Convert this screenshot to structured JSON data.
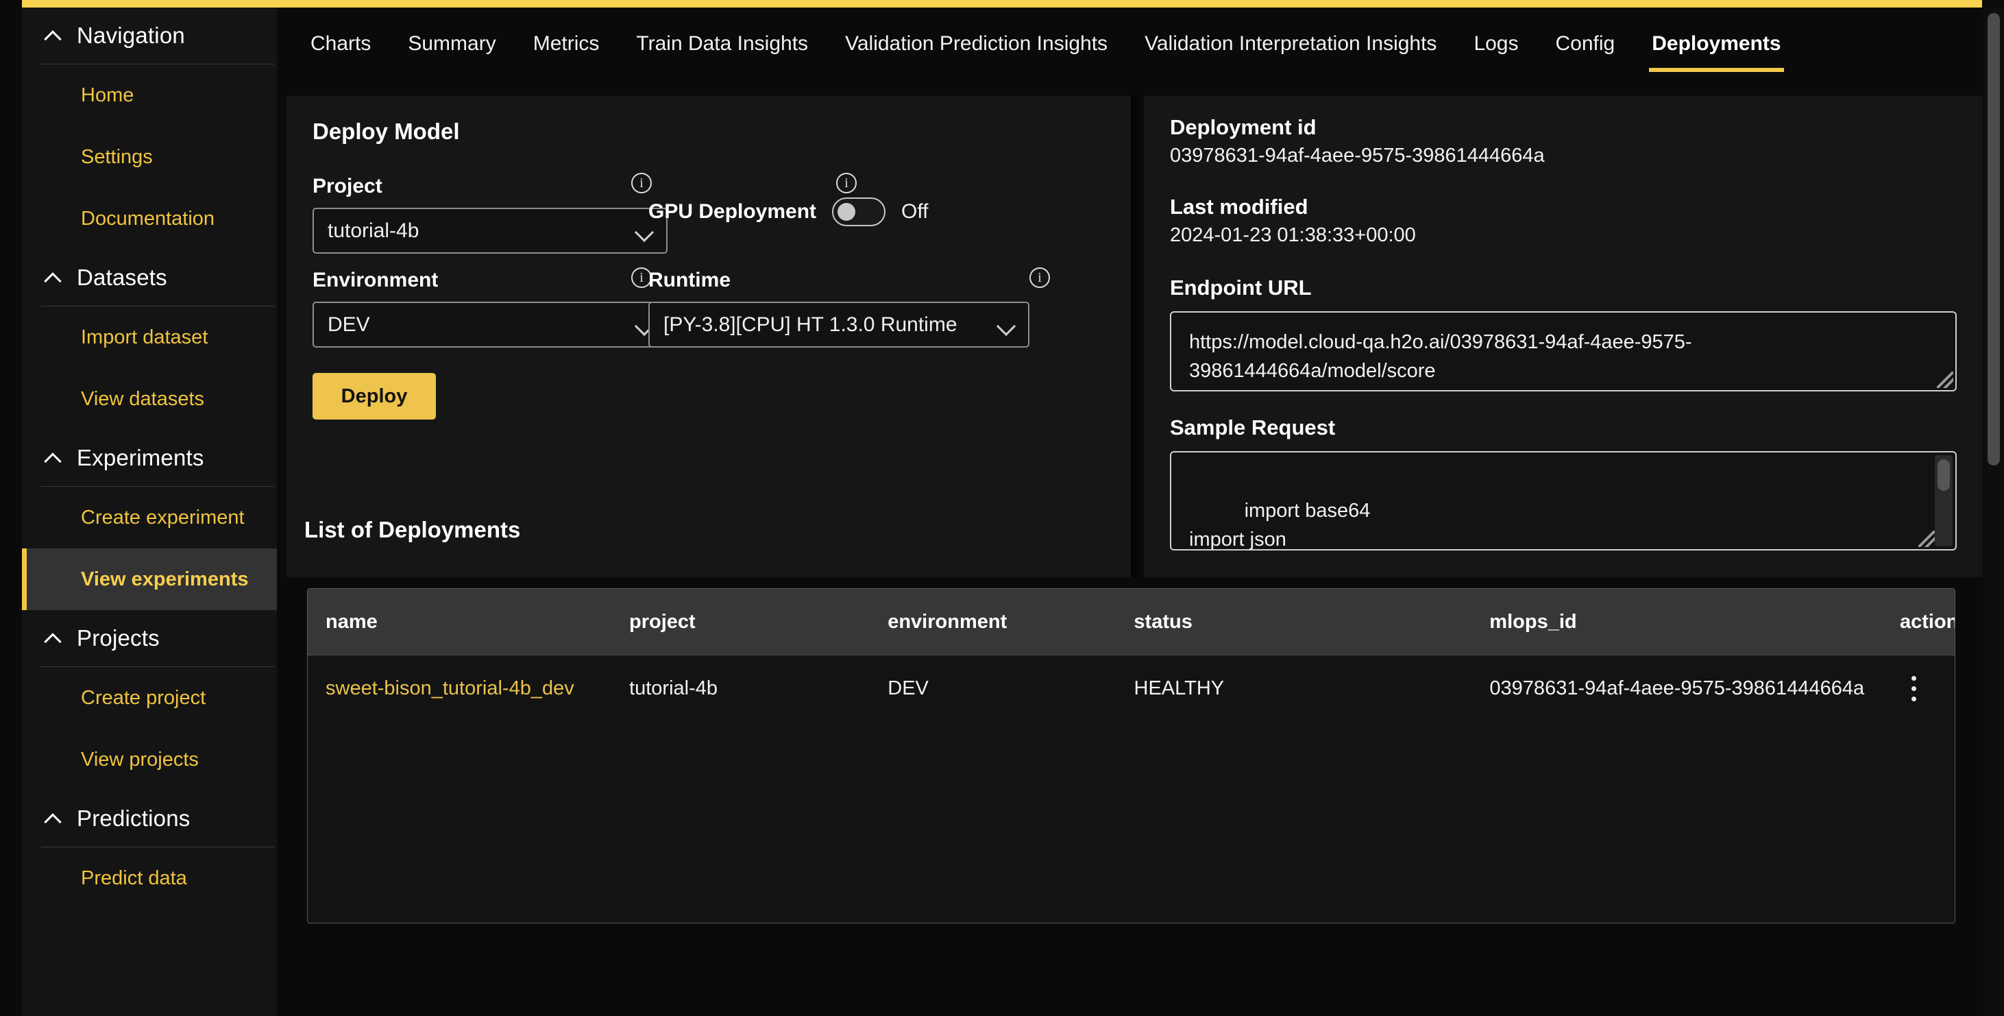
{
  "sidebar": {
    "groups": [
      {
        "title": "Navigation",
        "items": [
          {
            "label": "Home",
            "selected": false
          },
          {
            "label": "Settings",
            "selected": false
          },
          {
            "label": "Documentation",
            "selected": false
          }
        ]
      },
      {
        "title": "Datasets",
        "items": [
          {
            "label": "Import dataset",
            "selected": false
          },
          {
            "label": "View datasets",
            "selected": false
          }
        ]
      },
      {
        "title": "Experiments",
        "items": [
          {
            "label": "Create experiment",
            "selected": false
          },
          {
            "label": "View experiments",
            "selected": true
          }
        ]
      },
      {
        "title": "Projects",
        "items": [
          {
            "label": "Create project",
            "selected": false
          },
          {
            "label": "View projects",
            "selected": false
          }
        ]
      },
      {
        "title": "Predictions",
        "items": [
          {
            "label": "Predict data",
            "selected": false
          }
        ]
      }
    ]
  },
  "tabs": [
    {
      "label": "Charts",
      "active": false
    },
    {
      "label": "Summary",
      "active": false
    },
    {
      "label": "Metrics",
      "active": false
    },
    {
      "label": "Train Data Insights",
      "active": false
    },
    {
      "label": "Validation Prediction Insights",
      "active": false
    },
    {
      "label": "Validation Interpretation Insights",
      "active": false
    },
    {
      "label": "Logs",
      "active": false
    },
    {
      "label": "Config",
      "active": false
    },
    {
      "label": "Deployments",
      "active": true
    }
  ],
  "deploy_model": {
    "title": "Deploy Model",
    "project": {
      "label": "Project",
      "value": "tutorial-4b",
      "info": "i"
    },
    "environment": {
      "label": "Environment",
      "value": "DEV",
      "info": "i"
    },
    "gpu": {
      "label": "GPU Deployment",
      "state": "Off",
      "info": "i"
    },
    "runtime": {
      "label": "Runtime",
      "value": "[PY-3.8][CPU] HT 1.3.0 Runtime",
      "info": "i"
    },
    "deploy_button": "Deploy"
  },
  "deployment_info": {
    "deployment_id_label": "Deployment id",
    "deployment_id_value": "03978631-94af-4aee-9575-39861444664a",
    "last_modified_label": "Last modified",
    "last_modified_value": "2024-01-23 01:38:33+00:00",
    "endpoint_url_label": "Endpoint URL",
    "endpoint_url_value": "https://model.cloud-qa.h2o.ai/03978631-94af-4aee-9575-39861444664a/model/score",
    "sample_request_label": "Sample Request",
    "sample_request_value": "import base64\nimport json"
  },
  "list_of_deployments": {
    "title": "List of Deployments",
    "columns": [
      "name",
      "project",
      "environment",
      "status",
      "mlops_id",
      "action"
    ],
    "rows": [
      {
        "name": "sweet-bison_tutorial-4b_dev",
        "project": "tutorial-4b",
        "environment": "DEV",
        "status": "HEALTHY",
        "mlops_id": "03978631-94af-4aee-9575-39861444664a",
        "action": "kebab-menu"
      }
    ]
  },
  "colors": {
    "accent": "#f3c84c",
    "link": "#eac34a",
    "panel": "#161616",
    "background": "#0a0a0a",
    "header_row": "#373737"
  }
}
